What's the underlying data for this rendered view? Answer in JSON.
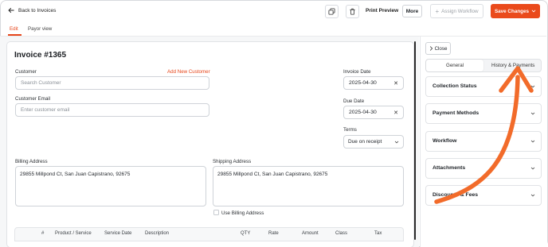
{
  "header": {
    "back_label": "Back to Invoices",
    "print_preview": "Print Preview",
    "more": "More",
    "assign_workflow": "Assign Workflow",
    "save_changes": "Save Changes"
  },
  "tabs": [
    {
      "label": "Edit",
      "active": true
    },
    {
      "label": "Payor view",
      "active": false
    }
  ],
  "invoice": {
    "title": "Invoice #1365",
    "customer_label": "Customer",
    "add_new_customer": "Add New Customer",
    "search_customer_placeholder": "Search Customer",
    "customer_email_label": "Customer Email",
    "customer_email_placeholder": "Enter customer email",
    "invoice_date_label": "Invoice Date",
    "invoice_date": "2025-04-30",
    "due_date_label": "Due Date",
    "due_date": "2025-04-30",
    "terms_label": "Terms",
    "terms_value": "Due on receipt",
    "billing_address_label": "Billing Address",
    "billing_address": "29855 Millpond Ct, San Juan Capistrano, 92675",
    "shipping_address_label": "Shipping Address",
    "shipping_address": "29855 Millpond Ct, San Juan Capistrano, 92675",
    "use_billing_address": "Use Billing Address"
  },
  "line_items_table": {
    "columns": [
      "#",
      "Product / Service",
      "Service Date",
      "Description",
      "QTY",
      "Rate",
      "Amount",
      "Class",
      "Tax"
    ]
  },
  "right_panel": {
    "close_label": "Close",
    "tabs": [
      {
        "label": "General",
        "active": true
      },
      {
        "label": "History & Payments",
        "active": false
      }
    ],
    "sections": [
      "Collection Status",
      "Payment Methods",
      "Workflow",
      "Attachments",
      "Discounts & Fees"
    ]
  },
  "colors": {
    "accent": "#ea4a1b",
    "annotation_arrow": "#f26b2a"
  },
  "icons": {
    "back": "arrow-left-icon",
    "duplicate": "copy-icon",
    "delete": "trash-icon",
    "assign": "plus-icon",
    "save_dropdown": "chevron-down-icon",
    "close": "chevron-right-icon",
    "clear_date": "close-icon",
    "accordion": "chevron-down-icon"
  }
}
